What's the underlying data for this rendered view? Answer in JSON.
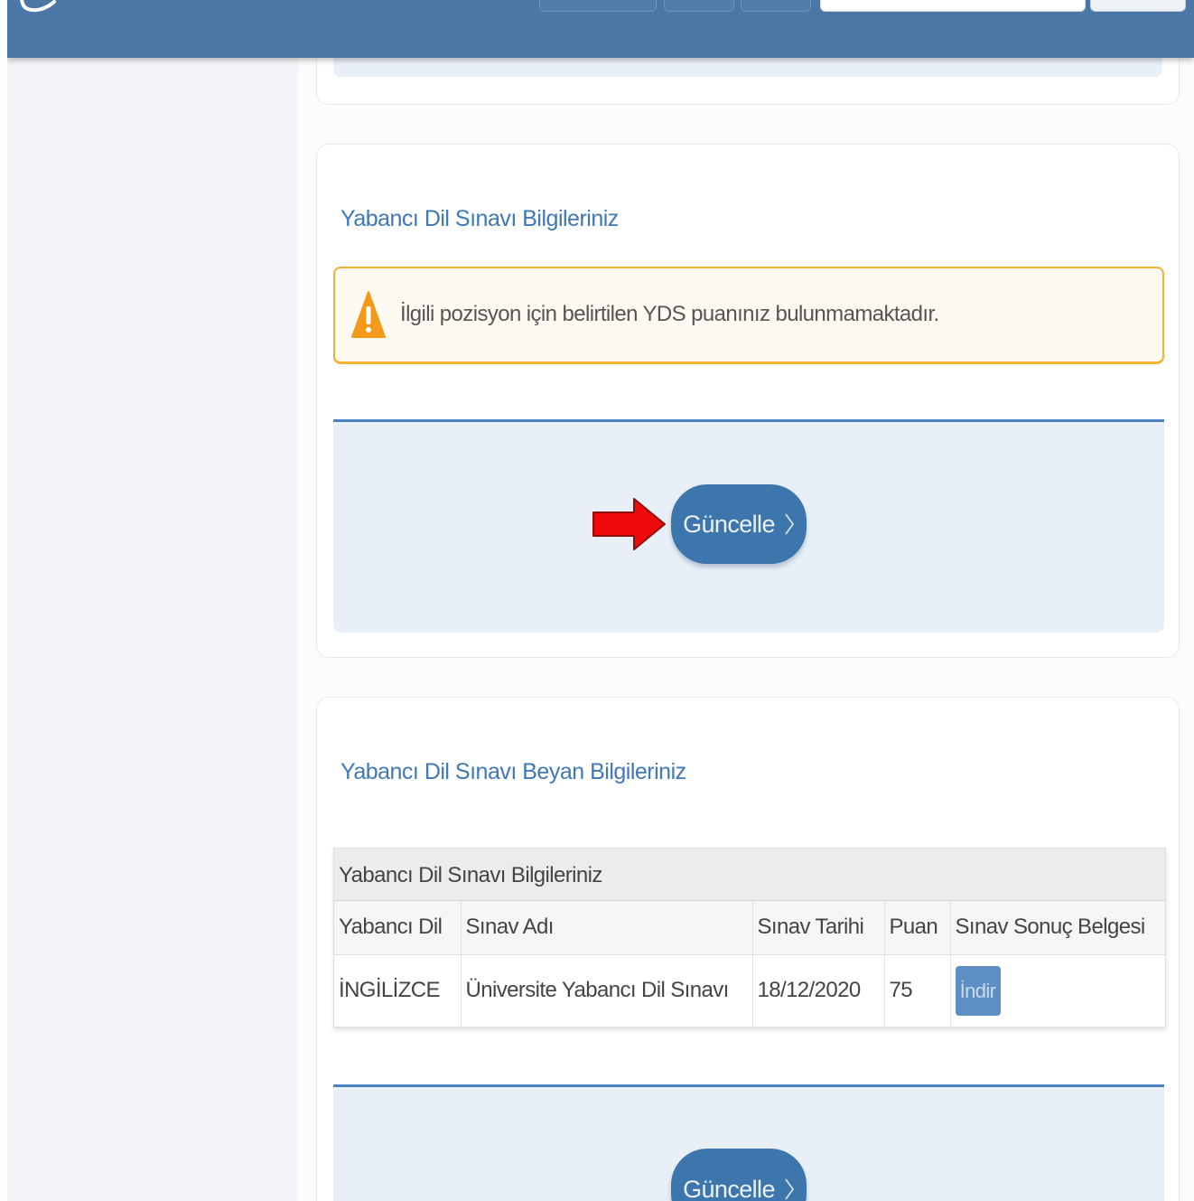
{
  "sections": {
    "exam_info": {
      "title": "Yabancı Dil Sınavı Bilgileriniz",
      "alert_text": "İlgili pozisyon için belirtilen YDS puanınız bulunmamaktadır.",
      "update_label": "Güncelle"
    },
    "declaration": {
      "title": "Yabancı Dil Sınavı Beyan Bilgileriniz",
      "table_caption": "Yabancı Dil Sınavı Bilgileriniz",
      "columns": [
        "Yabancı Dil",
        "Sınav Adı",
        "Sınav Tarihi",
        "Puan",
        "Sınav Sonuç Belgesi"
      ],
      "rows": [
        {
          "language": "İNGİLİZCE",
          "exam_name": "Üniversite Yabancı Dil Sınavı",
          "exam_date": "18/12/2020",
          "score": "75",
          "document_action": "İndir"
        }
      ],
      "update_label": "Güncelle"
    }
  },
  "colors": {
    "header": "#4a77a5",
    "accent": "#3e78b6",
    "button": "#3d75ad",
    "warning_border": "#f4b233",
    "warning_icon": "#f49a1b",
    "annotation_arrow": "#ff0000"
  },
  "icons": {
    "logo": "logo-swirl-icon",
    "alert": "warning-triangle-icon",
    "button_chevron": "chevron-right-icon",
    "annotation": "red-arrow-icon"
  }
}
